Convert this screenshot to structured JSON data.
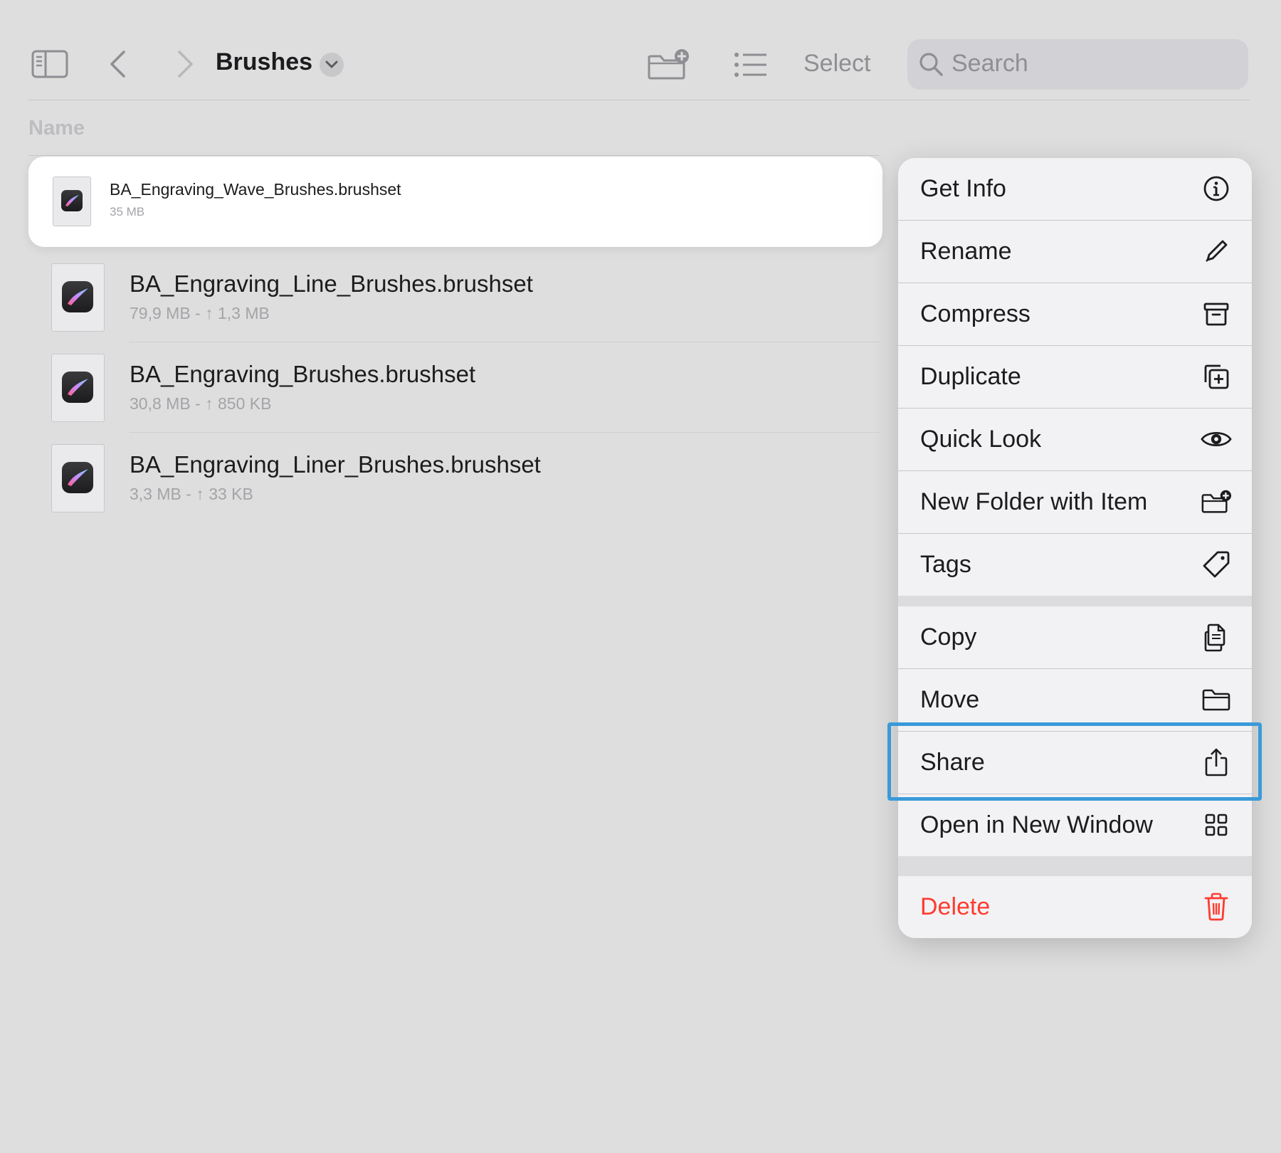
{
  "toolbar": {
    "title": "Brushes",
    "select_label": "Select",
    "search_placeholder": "Search",
    "icons": {
      "sidebar": "sidebar-icon",
      "back": "chevron-left-icon",
      "forward": "chevron-right-icon",
      "title_menu": "chevron-down-icon",
      "new_folder": "folder-plus-icon",
      "view": "list-icon",
      "search": "magnifier-icon"
    }
  },
  "list": {
    "column_header": "Name",
    "selected_file": {
      "name": "BA_Engraving_Wave_Brushes.brushset",
      "meta": "35 MB"
    },
    "files": [
      {
        "name": "BA_Engraving_Line_Brushes.brushset",
        "meta": "79,9 MB - ↑ 1,3 MB"
      },
      {
        "name": "BA_Engraving_Brushes.brushset",
        "meta": "30,8 MB - ↑ 850 KB"
      },
      {
        "name": "BA_Engraving_Liner_Brushes.brushset",
        "meta": "3,3 MB - ↑ 33 KB"
      }
    ]
  },
  "menu": {
    "items": [
      {
        "label": "Get Info",
        "icon": "info-icon"
      },
      {
        "label": "Rename",
        "icon": "pencil-icon"
      },
      {
        "label": "Compress",
        "icon": "archive-box-icon"
      },
      {
        "label": "Duplicate",
        "icon": "duplicate-icon"
      },
      {
        "label": "Quick Look",
        "icon": "eye-icon"
      },
      {
        "label": "New Folder with Item",
        "icon": "folder-plus-icon"
      },
      {
        "label": "Tags",
        "icon": "tag-icon"
      },
      {
        "label": "Copy",
        "icon": "copy-document-icon"
      },
      {
        "label": "Move",
        "icon": "folder-icon"
      },
      {
        "label": "Share",
        "icon": "share-icon"
      },
      {
        "label": "Open in New Window",
        "icon": "grid-icon"
      },
      {
        "label": "Delete",
        "icon": "trash-icon"
      }
    ],
    "highlighted": "Share"
  },
  "colors": {
    "background": "#dedede",
    "menu_item": "#f2f2f4",
    "destructive": "#ff3b30",
    "highlight_border": "#3a9ad9",
    "secondary_text": "#8e8e93"
  }
}
